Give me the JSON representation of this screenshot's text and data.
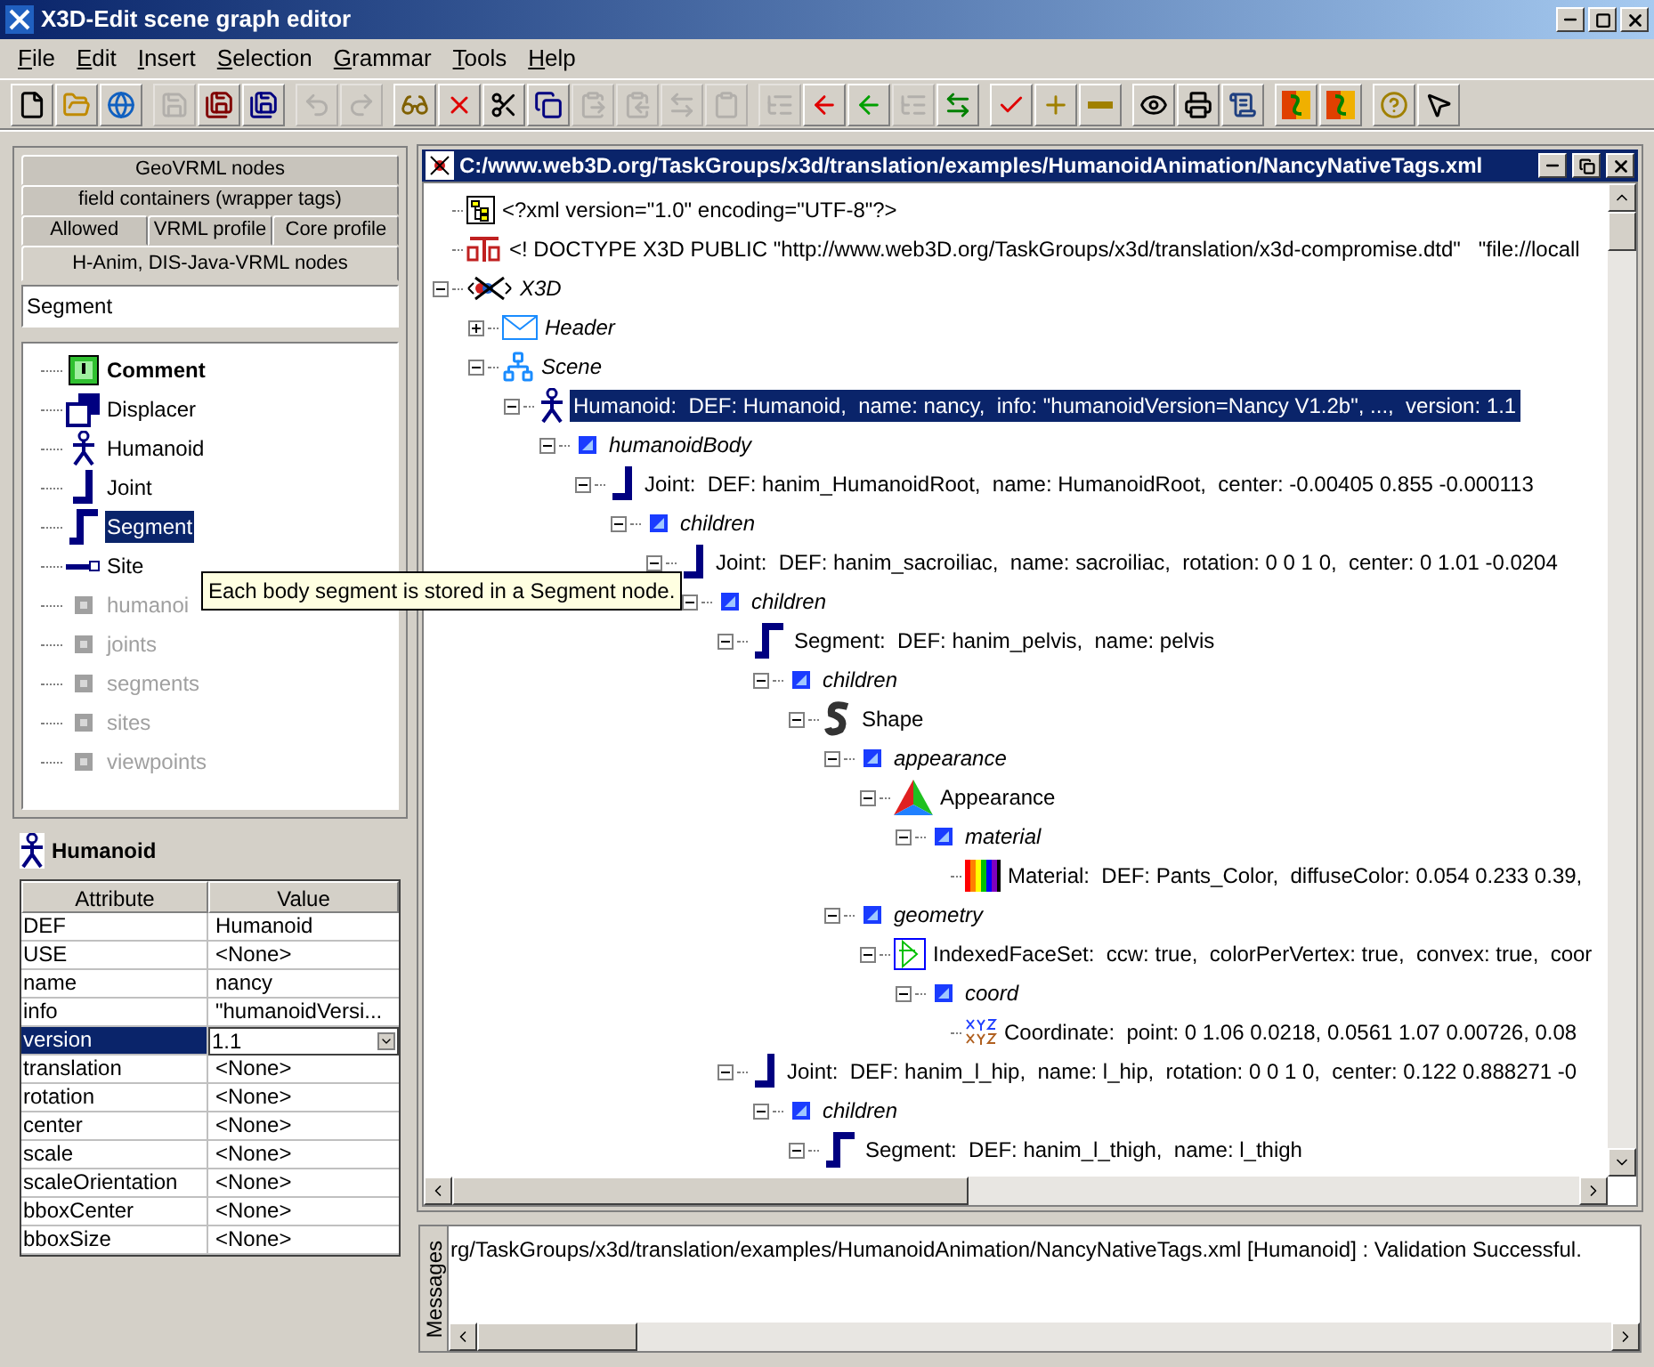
{
  "window": {
    "title": "X3D-Edit scene graph editor"
  },
  "menu": [
    "File",
    "Edit",
    "Insert",
    "Selection",
    "Grammar",
    "Tools",
    "Help"
  ],
  "toolbar": [
    [
      {
        "disabled": false
      },
      {
        "disabled": false
      },
      {
        "disabled": false
      }
    ],
    [
      {
        "disabled": true
      },
      {
        "disabled": false
      },
      {
        "disabled": false
      }
    ],
    [
      {
        "disabled": true
      },
      {
        "disabled": true
      }
    ],
    [
      {
        "disabled": false
      },
      {
        "disabled": false
      },
      {
        "disabled": false
      },
      {
        "disabled": false
      },
      {
        "disabled": true
      },
      {
        "disabled": true
      },
      {
        "disabled": true
      },
      {
        "disabled": true
      }
    ],
    [
      {
        "disabled": true
      },
      {
        "disabled": false
      },
      {
        "disabled": false
      },
      {
        "disabled": true
      },
      {
        "disabled": false
      }
    ],
    [
      {
        "disabled": false
      },
      {
        "disabled": false
      },
      {
        "disabled": false
      }
    ],
    [
      {
        "disabled": false
      },
      {
        "disabled": false
      },
      {
        "disabled": false
      }
    ],
    [
      {
        "disabled": false
      },
      {
        "disabled": false
      }
    ],
    [
      {
        "disabled": false
      },
      {
        "disabled": false
      }
    ]
  ],
  "palette": {
    "tab_rows": [
      [
        {
          "label": "GeoVRML nodes",
          "selected": false
        }
      ],
      [
        {
          "label": "field containers (wrapper tags)",
          "selected": false
        }
      ],
      [
        {
          "label": "Allowed",
          "selected": false
        },
        {
          "label": "VRML profile",
          "selected": false
        },
        {
          "label": "Core profile",
          "selected": false
        }
      ],
      [
        {
          "label": "H-Anim, DIS-Java-VRML nodes",
          "selected": true
        }
      ]
    ],
    "search": {
      "value": "Segment"
    },
    "items": [
      {
        "label": "Comment",
        "kind": "comment",
        "selected": false,
        "disabled": false
      },
      {
        "label": "Displacer",
        "kind": "displacer",
        "selected": false,
        "disabled": false
      },
      {
        "label": "Humanoid",
        "kind": "humanoid",
        "selected": false,
        "disabled": false
      },
      {
        "label": "Joint",
        "kind": "joint",
        "selected": false,
        "disabled": false
      },
      {
        "label": "Segment",
        "kind": "segment",
        "selected": true,
        "disabled": false
      },
      {
        "label": "Site",
        "kind": "site",
        "selected": false,
        "disabled": false
      },
      {
        "label": "humanoi",
        "kind": "field",
        "selected": false,
        "disabled": true
      },
      {
        "label": "joints",
        "kind": "field",
        "selected": false,
        "disabled": true
      },
      {
        "label": "segments",
        "kind": "field",
        "selected": false,
        "disabled": true
      },
      {
        "label": "sites",
        "kind": "field",
        "selected": false,
        "disabled": true
      },
      {
        "label": "viewpoints",
        "kind": "field",
        "selected": false,
        "disabled": true
      }
    ]
  },
  "tooltip": "Each body segment is stored in a Segment node.",
  "properties": {
    "title": "Humanoid",
    "columns": [
      "Attribute",
      "Value"
    ],
    "rows": [
      {
        "attribute": "DEF",
        "value": "Humanoid",
        "selected": false
      },
      {
        "attribute": "USE",
        "value": "<None>",
        "selected": false
      },
      {
        "attribute": "name",
        "value": "nancy",
        "selected": false
      },
      {
        "attribute": "info",
        "value": "\"humanoidVersi...",
        "selected": false
      },
      {
        "attribute": "version",
        "value": "1.1",
        "selected": true
      },
      {
        "attribute": "translation",
        "value": "<None>",
        "selected": false
      },
      {
        "attribute": "rotation",
        "value": "<None>",
        "selected": false
      },
      {
        "attribute": "center",
        "value": "<None>",
        "selected": false
      },
      {
        "attribute": "scale",
        "value": "<None>",
        "selected": false
      },
      {
        "attribute": "scaleOrientation",
        "value": "<None>",
        "selected": false
      },
      {
        "attribute": "bboxCenter",
        "value": "<None>",
        "selected": false
      },
      {
        "attribute": "bboxSize",
        "value": "<None>",
        "selected": false
      }
    ]
  },
  "document": {
    "title": "C:/www.web3D.org/TaskGroups/x3d/translation/examples/HumanoidAnimation/NancyNativeTags.xml",
    "tree": [
      {
        "label": "<?xml version=\"1.0\" encoding=\"UTF-8\"?>",
        "kind": "xml",
        "selected": false
      },
      {
        "label": "<! DOCTYPE X3D PUBLIC \"http://www.web3D.org/TaskGroups/x3d/translation/x3d-compromise.dtd\"   \"file://locall",
        "kind": "dtd",
        "selected": false
      },
      {
        "label": "X3D",
        "kind": "x3d",
        "selected": false,
        "expanded": true,
        "children": [
          {
            "label": "Header",
            "kind": "header",
            "selected": false,
            "expanded": false
          },
          {
            "label": "Scene",
            "kind": "scene",
            "selected": false,
            "expanded": true,
            "children": [
              {
                "label": "Humanoid:  DEF: Humanoid,  name: nancy,  info: \"humanoidVersion=Nancy V1.2b\", ...,  version: 1.1",
                "kind": "humanoid",
                "selected": true,
                "expanded": true,
                "children": [
                  {
                    "label": "humanoidBody",
                    "kind": "field",
                    "selected": false,
                    "expanded": true,
                    "children": [
                      {
                        "label": "Joint:  DEF: hanim_HumanoidRoot,  name: HumanoidRoot,  center: -0.00405 0.855 -0.000113",
                        "kind": "joint",
                        "selected": false,
                        "expanded": true,
                        "children": [
                          {
                            "label": "children",
                            "kind": "field",
                            "selected": false,
                            "expanded": true,
                            "children": [
                              {
                                "label": "Joint:  DEF: hanim_sacroiliac,  name: sacroiliac,  rotation: 0 0 1 0,  center: 0 1.01 -0.0204",
                                "kind": "joint",
                                "selected": false,
                                "expanded": true,
                                "children": [
                                  {
                                    "label": "children",
                                    "kind": "field",
                                    "selected": false,
                                    "expanded": true,
                                    "children": [
                                      {
                                        "label": "Segment:  DEF: hanim_pelvis,  name: pelvis",
                                        "kind": "segment",
                                        "selected": false,
                                        "expanded": true,
                                        "children": [
                                          {
                                            "label": "children",
                                            "kind": "field",
                                            "selected": false,
                                            "expanded": true,
                                            "children": [
                                              {
                                                "label": "Shape",
                                                "kind": "shape",
                                                "selected": false,
                                                "expanded": true,
                                                "children": [
                                                  {
                                                    "label": "appearance",
                                                    "kind": "field",
                                                    "selected": false,
                                                    "expanded": true,
                                                    "children": [
                                                      {
                                                        "label": "Appearance",
                                                        "kind": "appearance",
                                                        "selected": false,
                                                        "expanded": true,
                                                        "children": [
                                                          {
                                                            "label": "material",
                                                            "kind": "field",
                                                            "selected": false,
                                                            "expanded": true,
                                                            "children": [
                                                              {
                                                                "label": "Material:  DEF: Pants_Color,  diffuseColor: 0.054 0.233 0.39,",
                                                                "kind": "material",
                                                                "selected": false
                                                              }
                                                            ]
                                                          }
                                                        ]
                                                      }
                                                    ]
                                                  },
                                                  {
                                                    "label": "geometry",
                                                    "kind": "field",
                                                    "selected": false,
                                                    "expanded": true,
                                                    "children": [
                                                      {
                                                        "label": "IndexedFaceSet:  ccw: true,  colorPerVertex: true,  convex: true,  coor",
                                                        "kind": "ifs",
                                                        "selected": false,
                                                        "expanded": true,
                                                        "children": [
                                                          {
                                                            "label": "coord",
                                                            "kind": "field",
                                                            "selected": false,
                                                            "expanded": true,
                                                            "children": [
                                                              {
                                                                "label": "Coordinate:  point: 0 1.06 0.0218, 0.0561 1.07 0.00726, 0.08",
                                                                "kind": "coordinate",
                                                                "selected": false
                                                              }
                                                            ]
                                                          }
                                                        ]
                                                      }
                                                    ]
                                                  }
                                                ]
                                              }
                                            ]
                                          }
                                        ]
                                      },
                                      {
                                        "label": "Joint:  DEF: hanim_l_hip,  name: l_hip,  rotation: 0 0 1 0,  center: 0.122 0.888271 -0",
                                        "kind": "joint",
                                        "selected": false,
                                        "expanded": true,
                                        "children": [
                                          {
                                            "label": "children",
                                            "kind": "field",
                                            "selected": false,
                                            "expanded": true,
                                            "children": [
                                              {
                                                "label": "Segment:  DEF: hanim_l_thigh,  name: l_thigh",
                                                "kind": "segment",
                                                "selected": false,
                                                "expanded": true
                                              }
                                            ]
                                          }
                                        ]
                                      }
                                    ]
                                  }
                                ]
                              }
                            ]
                          }
                        ]
                      }
                    ]
                  }
                ]
              }
            ]
          }
        ]
      }
    ]
  },
  "messages": {
    "tab": "Messages",
    "text": "rg/TaskGroups/x3d/translation/examples/HumanoidAnimation/NancyNativeTags.xml [Humanoid] : Validation Successful."
  }
}
